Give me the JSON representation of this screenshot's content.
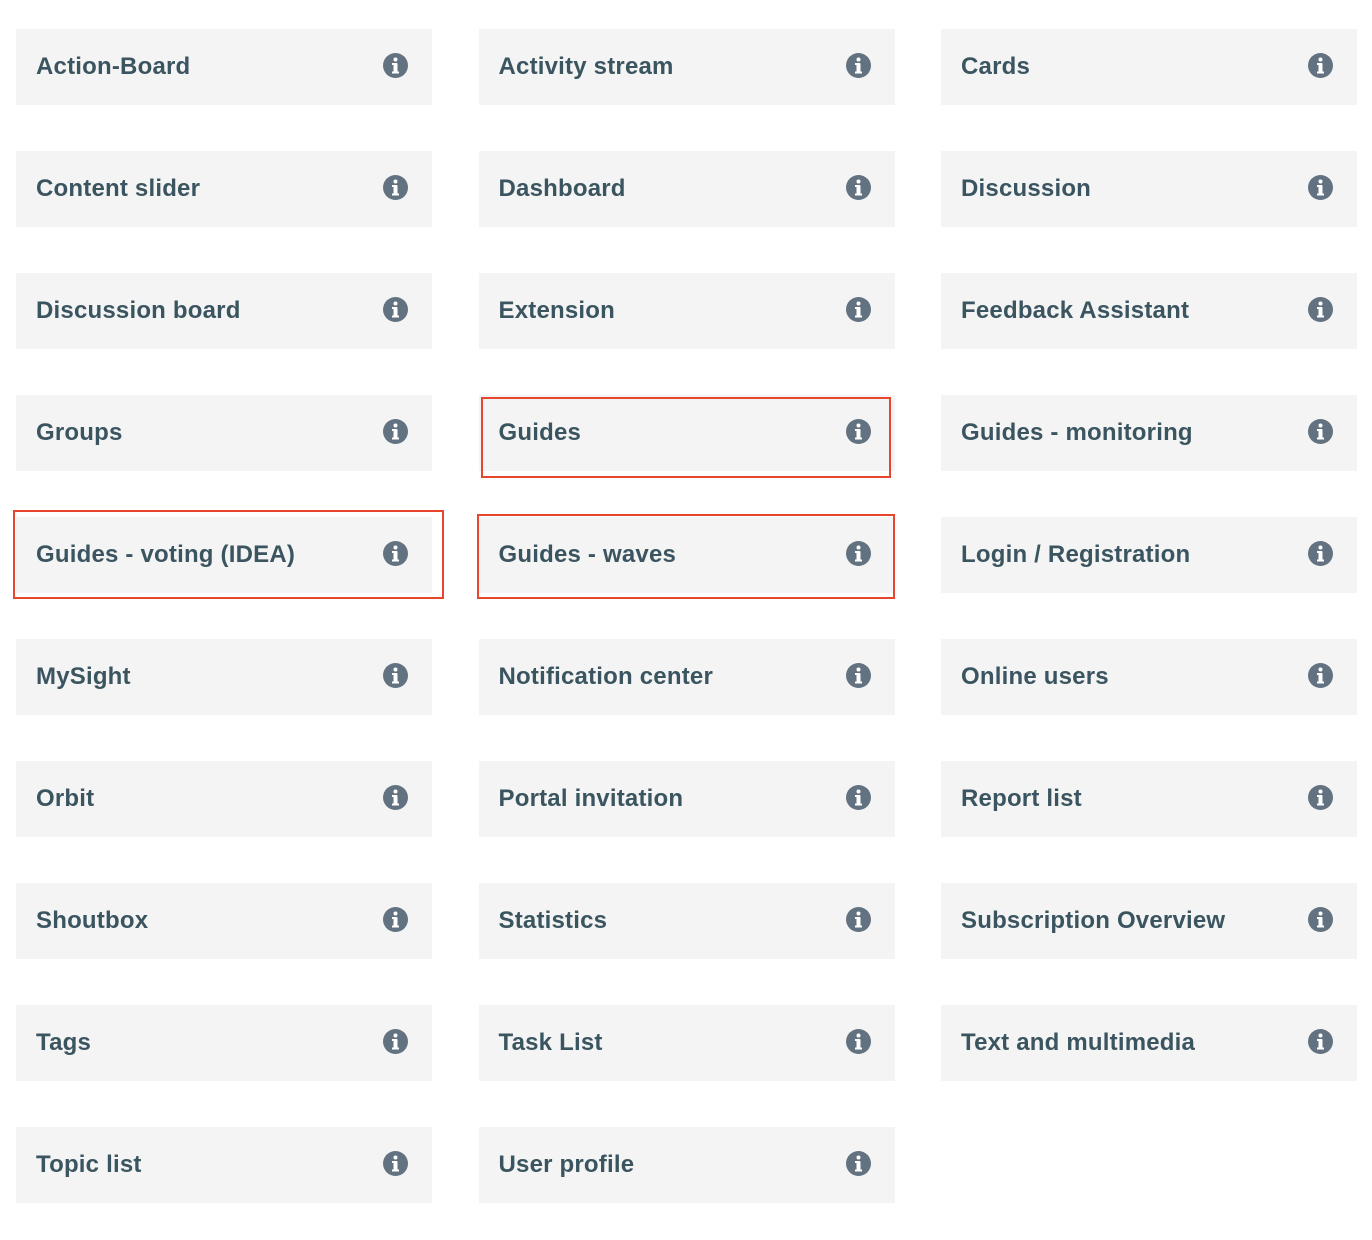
{
  "modules": [
    {
      "label": "Action-Board",
      "icon": "info-icon"
    },
    {
      "label": "Activity stream",
      "icon": "info-icon"
    },
    {
      "label": "Cards",
      "icon": "info-icon"
    },
    {
      "label": "Content slider",
      "icon": "info-icon"
    },
    {
      "label": "Dashboard",
      "icon": "info-icon"
    },
    {
      "label": "Discussion",
      "icon": "info-icon"
    },
    {
      "label": "Discussion board",
      "icon": "info-icon"
    },
    {
      "label": "Extension",
      "icon": "info-icon"
    },
    {
      "label": "Feedback Assistant",
      "icon": "info-icon"
    },
    {
      "label": "Groups",
      "icon": "info-icon"
    },
    {
      "label": "Guides",
      "icon": "info-icon",
      "highlighted": true
    },
    {
      "label": "Guides - monitoring",
      "icon": "info-icon"
    },
    {
      "label": "Guides - voting (IDEA)",
      "icon": "info-icon",
      "highlighted": true
    },
    {
      "label": "Guides - waves",
      "icon": "info-icon",
      "highlighted": true
    },
    {
      "label": "Login / Registration",
      "icon": "info-icon"
    },
    {
      "label": "MySight",
      "icon": "info-icon"
    },
    {
      "label": "Notification center",
      "icon": "info-icon"
    },
    {
      "label": "Online users",
      "icon": "info-icon"
    },
    {
      "label": "Orbit",
      "icon": "info-icon"
    },
    {
      "label": "Portal invitation",
      "icon": "info-icon"
    },
    {
      "label": "Report list",
      "icon": "info-icon"
    },
    {
      "label": "Shoutbox",
      "icon": "info-icon"
    },
    {
      "label": "Statistics",
      "icon": "info-icon"
    },
    {
      "label": "Subscription Overview",
      "icon": "info-icon"
    },
    {
      "label": "Tags",
      "icon": "info-icon"
    },
    {
      "label": "Task List",
      "icon": "info-icon"
    },
    {
      "label": "Text and multimedia",
      "icon": "info-icon"
    },
    {
      "label": "Topic list",
      "icon": "info-icon"
    },
    {
      "label": "User profile",
      "icon": "info-icon"
    }
  ],
  "colors": {
    "tile_background": "#f4f4f4",
    "label_text": "#3b5560",
    "info_icon": "#627280",
    "highlight_border": "#e8452f"
  }
}
